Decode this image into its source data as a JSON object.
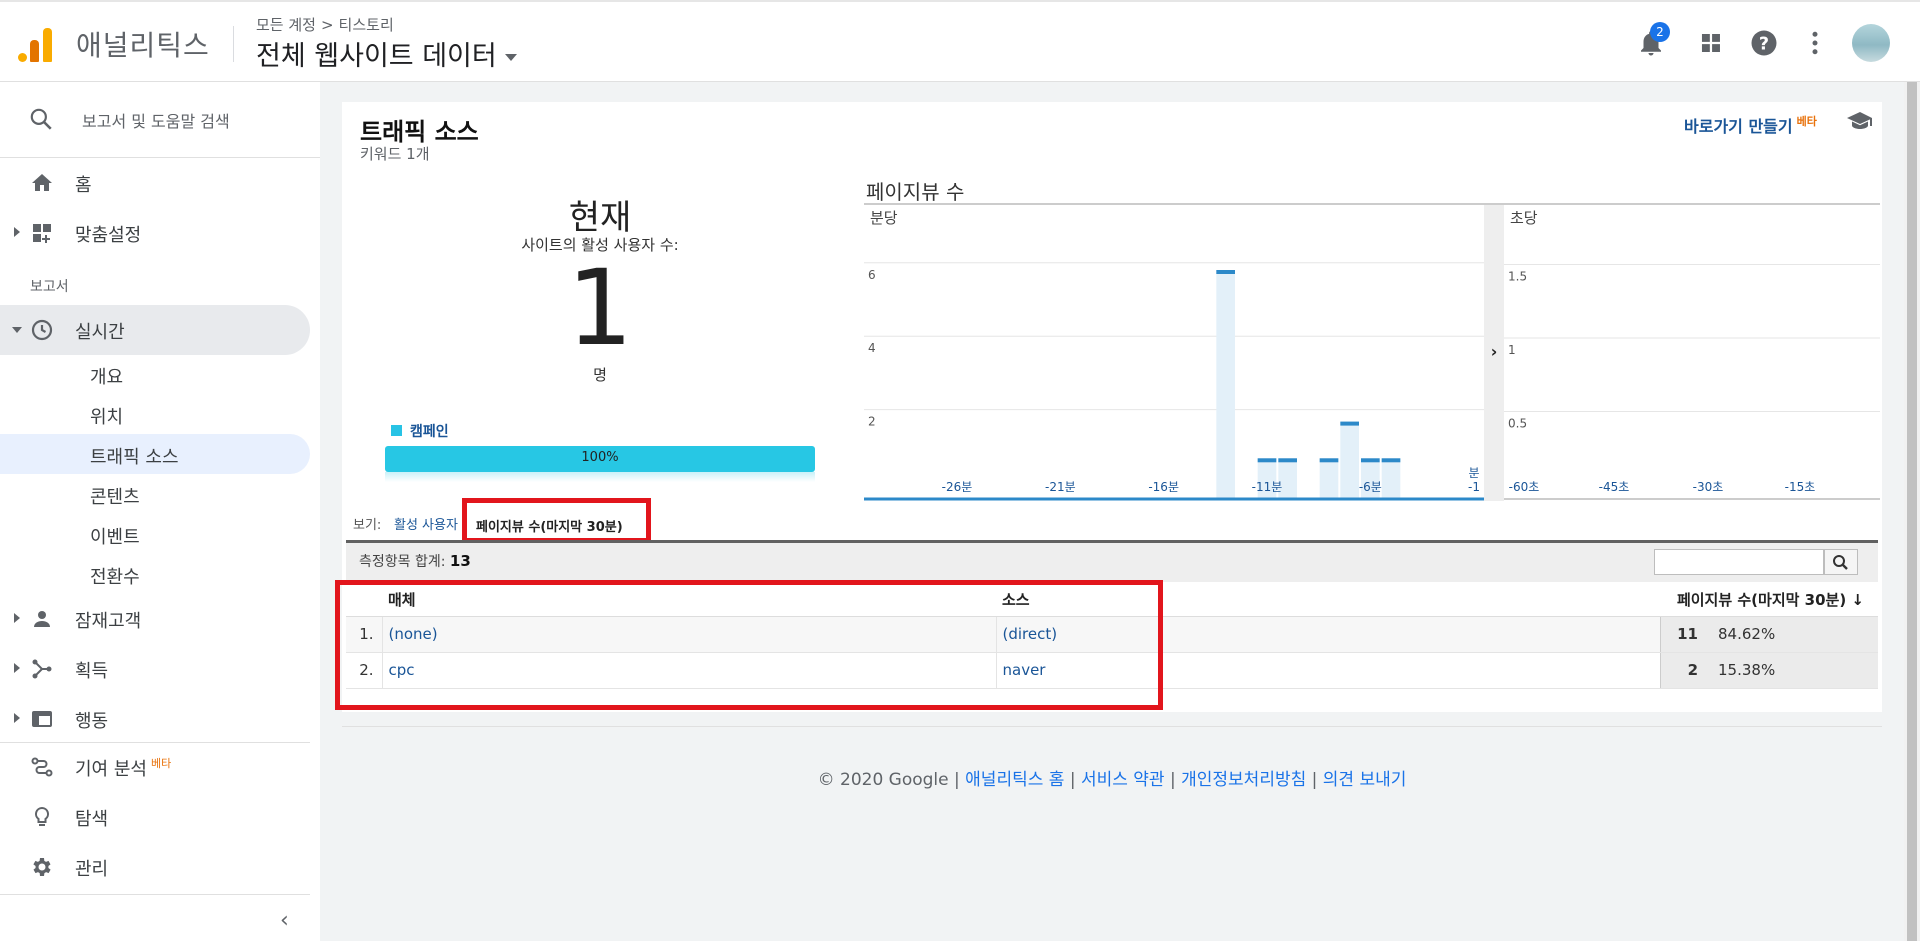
{
  "header": {
    "brand": "애널리틱스",
    "breadcrumb": [
      "모든 계정",
      "티스토리"
    ],
    "breadcrumb_sep": ">",
    "view_name": "전체 웹사이트 데이터",
    "notification_count": "2"
  },
  "sidebar": {
    "search_placeholder": "보고서 및 도움말 검색",
    "top_items": [
      {
        "label": "홈",
        "icon": "home-icon"
      },
      {
        "label": "맞춤설정",
        "icon": "dashboard-icon"
      }
    ],
    "section_label": "보고서",
    "realtime": {
      "label": "실시간",
      "subitems": [
        "개요",
        "위치",
        "트래픽 소스",
        "콘텐츠",
        "이벤트",
        "전환수"
      ],
      "active_sub": "트래픽 소스"
    },
    "report_items": [
      {
        "label": "잠재고객",
        "icon": "person-icon"
      },
      {
        "label": "획득",
        "icon": "acquisition-icon"
      },
      {
        "label": "행동",
        "icon": "behavior-icon"
      }
    ],
    "bottom_items": [
      {
        "label": "기여 분석",
        "icon": "attribution-icon",
        "badge": "베타"
      },
      {
        "label": "탐색",
        "icon": "lightbulb-icon"
      },
      {
        "label": "관리",
        "icon": "gear-icon"
      }
    ]
  },
  "report": {
    "title": "트래픽 소스",
    "subtitle": "키워드 1개",
    "shortcut_label": "바로가기 만들기",
    "shortcut_badge": "베타"
  },
  "now": {
    "title": "현재",
    "subtitle": "사이트의 활성 사용자 수:",
    "value": "1",
    "unit": "명",
    "legend_label": "캠페인",
    "legend_color": "#28c3e5",
    "bar_fraction": 1.0,
    "bar_label": "100%"
  },
  "chart_data": [
    {
      "type": "bar",
      "title": "페이지뷰 수",
      "panel_label": "분당",
      "x_tick_labels": [
        "-26분",
        "-21분",
        "-16분",
        "-11분",
        "-6분",
        "분 -1"
      ],
      "y_tick_labels": [
        "2",
        "4",
        "6"
      ],
      "ylim": [
        0,
        8
      ],
      "x": [
        -30,
        -29,
        -28,
        -27,
        -26,
        -25,
        -24,
        -23,
        -22,
        -21,
        -20,
        -19,
        -18,
        -17,
        -16,
        -15,
        -14,
        -13,
        -12,
        -11,
        -10,
        -9,
        -8,
        -7,
        -6,
        -5,
        -4,
        -3,
        -2,
        -1
      ],
      "values": [
        0,
        0,
        0,
        0,
        0,
        0,
        0,
        0,
        0,
        0,
        0,
        0,
        0,
        0,
        0,
        0,
        0,
        6,
        0,
        1,
        1,
        0,
        1,
        2,
        1,
        1,
        0,
        0,
        0,
        0
      ],
      "bar_color": "#2c89c9"
    },
    {
      "type": "bar",
      "panel_label": "초당",
      "x_tick_labels": [
        "-60초",
        "-45초",
        "-30초",
        "-15초"
      ],
      "y_tick_labels": [
        "0.5",
        "1",
        "1.5"
      ],
      "ylim": [
        0,
        2
      ],
      "values": []
    }
  ],
  "view_toggle": {
    "label": "보기:",
    "option_inactive": "활성 사용자",
    "option_active": "페이지뷰 수(마지막 30분)"
  },
  "totals": {
    "label": "측정항목 합계:",
    "value": "13"
  },
  "table": {
    "headers": [
      "매체",
      "소스",
      "페이지뷰 수(마지막 30분)"
    ],
    "rows": [
      {
        "idx": "1.",
        "medium": "(none)",
        "source": "(direct)",
        "count": "11",
        "pct": "84.62%"
      },
      {
        "idx": "2.",
        "medium": "cpc",
        "source": "naver",
        "count": "2",
        "pct": "15.38%"
      }
    ]
  },
  "footer": {
    "copyright": "© 2020 Google",
    "links": [
      "애널리틱스 홈",
      "서비스 약관",
      "개인정보처리방침",
      "의견 보내기"
    ],
    "sep": "|"
  }
}
